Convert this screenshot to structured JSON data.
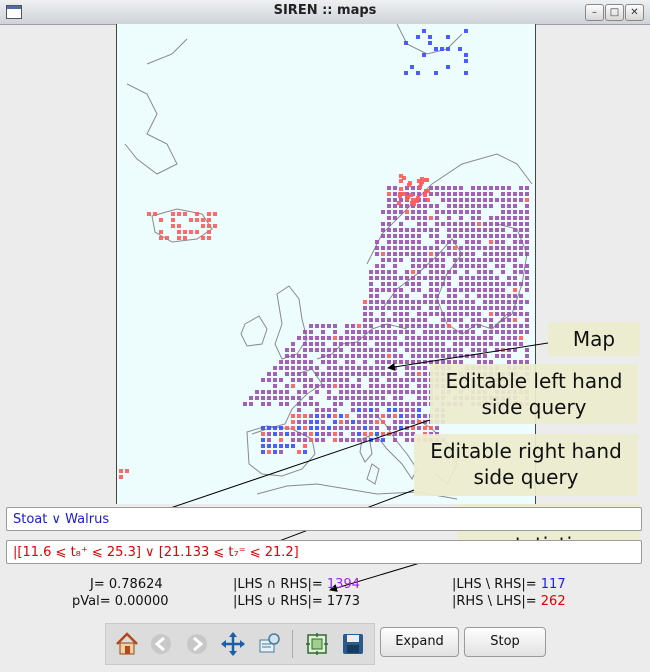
{
  "window": {
    "title": "SIREN :: maps",
    "min_glyph": "–",
    "max_glyph": "□",
    "close_glyph": "✕"
  },
  "map": {
    "background": "#edfdfd",
    "lhs_color": "#3a4cff",
    "rhs_color": "#ff5a5a",
    "both_color": "#9b4fb0"
  },
  "callouts": {
    "map": "Map",
    "lhs": "Editable left hand side query",
    "rhs": "Editable right hand side query",
    "stats": "Redescription statistics"
  },
  "queries": {
    "lhs": "Stoat ∨ Walrus",
    "rhs": "[11.6 ⩽ t₈⁺ ⩽ 25.3] ∨  [21.133 ⩽ t₇⁼ ⩽ 21.2]"
  },
  "stats": {
    "j_label": "J=",
    "j_value": "0.78624",
    "pval_label": "pVal=",
    "pval_value": "0.00000",
    "inter_label": "|LHS ∩ RHS|=",
    "inter_value": "1394",
    "union_label": "|LHS ∪ RHS|=",
    "union_value": "1773",
    "lhs_minus_label": "|LHS \\ RHS|=",
    "lhs_minus_value": "117",
    "rhs_minus_label": "|RHS \\ LHS|=",
    "rhs_minus_value": "262"
  },
  "toolbar": {
    "icons": [
      "home-icon",
      "back-icon",
      "forward-icon",
      "pan-icon",
      "zoom-icon",
      "configure-subplots-icon",
      "save-icon"
    ]
  },
  "buttons": {
    "expand": "Expand",
    "stop": "Stop"
  }
}
